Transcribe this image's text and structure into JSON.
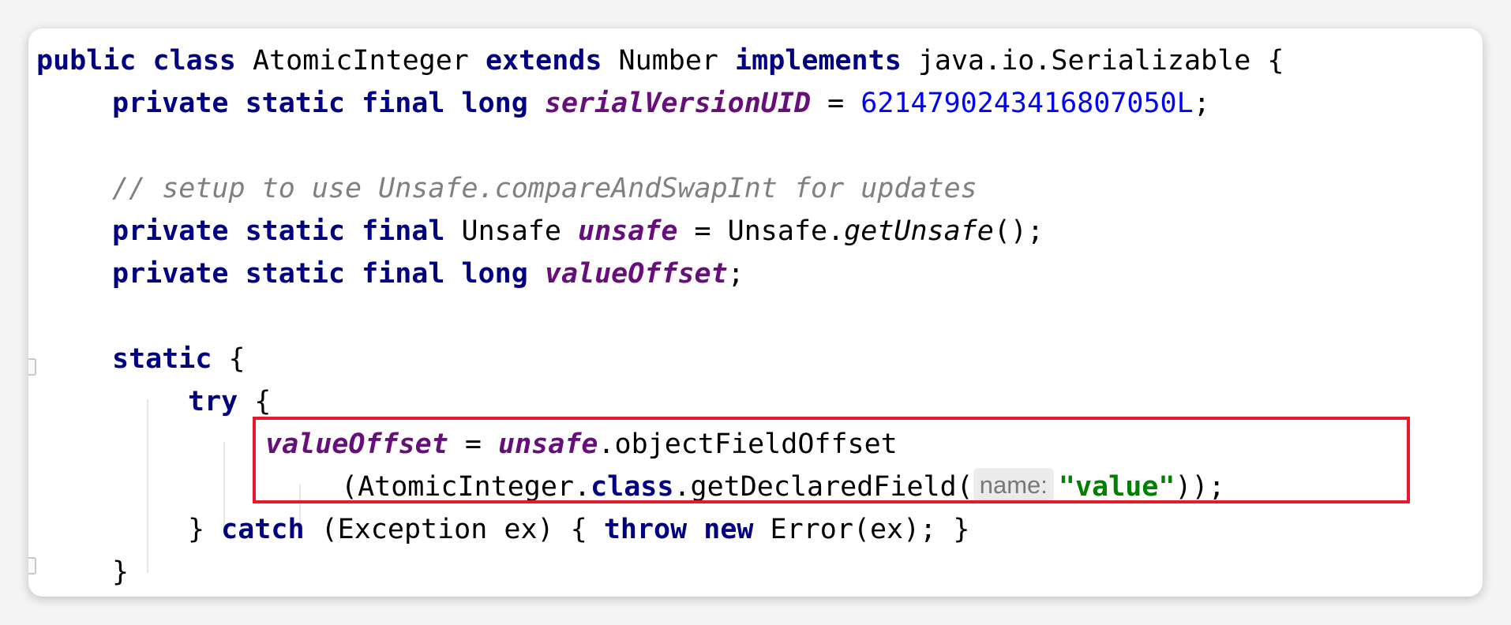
{
  "code": {
    "l1": {
      "kw_public_class": "public class",
      "cls": " AtomicInteger ",
      "kw_extends": "extends",
      "sup": " Number ",
      "kw_implements": "implements",
      "rest": " java.io.Serializable {"
    },
    "l2": {
      "kw": "private static final long",
      "field": "serialVersionUID",
      "eq": " = ",
      "num": "6214790243416807050L",
      "end": ";"
    },
    "l4": {
      "comment": "// setup to use Unsafe.compareAndSwapInt for updates"
    },
    "l5": {
      "kw": "private static final",
      "type": " Unsafe ",
      "field": "unsafe",
      "eq": " = Unsafe.",
      "call": "getUnsafe",
      "end": "();"
    },
    "l6": {
      "kw": "private static final long",
      "field": "valueOffset",
      "end": ";"
    },
    "l8": {
      "kw": "static",
      "brace": " {"
    },
    "l9": {
      "kw": "try",
      "brace": " {"
    },
    "l10": {
      "field1": "valueOffset",
      "eq": " = ",
      "field2": "unsafe",
      "call": ".objectFieldOffset"
    },
    "l11": {
      "open": "(AtomicInteger.",
      "kw": "class",
      "call": ".getDeclaredField(",
      "hint": "name:",
      "str": "\"value\"",
      "end": "));"
    },
    "l12": {
      "close": "} ",
      "kw_catch": "catch",
      "mid": " (Exception ex) { ",
      "kw_throw_new": "throw new",
      "end": " Error(ex); }"
    },
    "l13": {
      "close": "}"
    }
  },
  "colors": {
    "keyword": "#000080",
    "field": "#660e7a",
    "number": "#0000ff",
    "comment": "#808080",
    "string": "#008000",
    "highlight": "#e8192c"
  }
}
